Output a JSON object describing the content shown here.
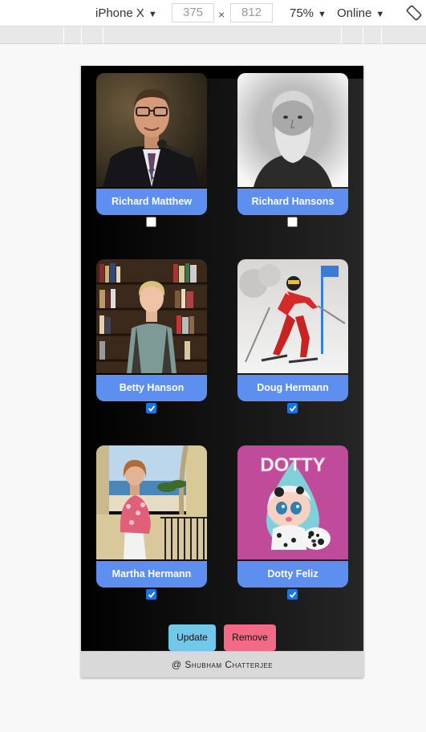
{
  "devtools": {
    "device": "iPhone X",
    "width": "375",
    "separator": "×",
    "height": "812",
    "zoom": "75%",
    "network": "Online",
    "caret": "▼"
  },
  "people": [
    {
      "name": "Richard Matthew",
      "checked": false
    },
    {
      "name": "Richard Hansons",
      "checked": false
    },
    {
      "name": "Betty Hanson",
      "checked": true
    },
    {
      "name": "Doug Hermann",
      "checked": true
    },
    {
      "name": "Martha Hermann",
      "checked": true
    },
    {
      "name": "Dotty Feliz",
      "checked": true
    }
  ],
  "dotty_poster_text": "DOTTY",
  "buttons": {
    "update": "Update",
    "remove": "Remove"
  },
  "footer": {
    "text": "@ Shubham Chatterjee"
  },
  "colors": {
    "name_bar": "#5d8ff0",
    "update_button": "#72c7ea",
    "remove_button": "#f26a86",
    "checkbox_checked": "#1a73e8"
  }
}
